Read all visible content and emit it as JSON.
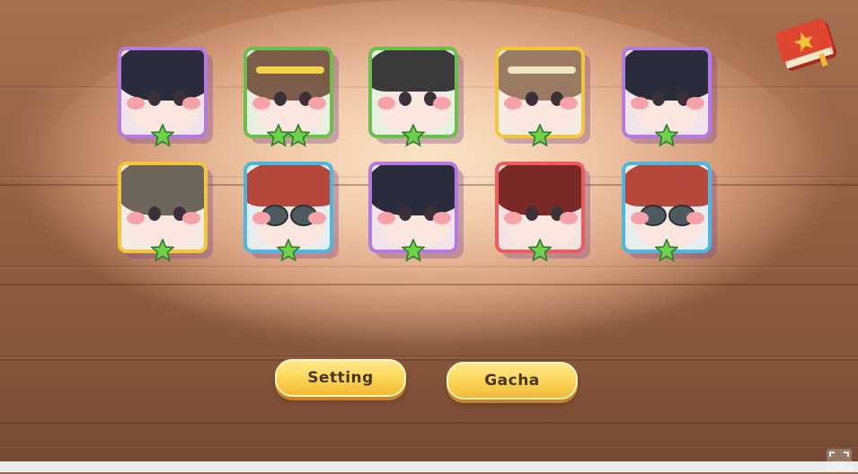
{
  "screen": {
    "buttons": [
      {
        "id": "setting",
        "label": "Setting"
      },
      {
        "id": "gacha",
        "label": "Gacha"
      }
    ]
  },
  "roster": {
    "characters": [
      {
        "slot": 1,
        "hair": "black",
        "frame_color": "#b57ae0",
        "stars": 1
      },
      {
        "slot": 2,
        "hair": "brown",
        "frame_color": "#6cc04a",
        "stars": 2
      },
      {
        "slot": 3,
        "hair": "black-cap",
        "frame_color": "#6cc04a",
        "stars": 1
      },
      {
        "slot": 4,
        "hair": "light-brown-headband",
        "frame_color": "#f3c53a",
        "stars": 1
      },
      {
        "slot": 5,
        "hair": "black",
        "frame_color": "#b57ae0",
        "stars": 1
      },
      {
        "slot": 6,
        "hair": "grey-brown",
        "frame_color": "#f3c53a",
        "stars": 1
      },
      {
        "slot": 7,
        "hair": "red-cap-sunglasses",
        "frame_color": "#4fb6e0",
        "stars": 1
      },
      {
        "slot": 8,
        "hair": "black",
        "frame_color": "#b57ae0",
        "stars": 1
      },
      {
        "slot": 9,
        "hair": "dark-red",
        "frame_color": "#ef5a5a",
        "stars": 1
      },
      {
        "slot": 10,
        "hair": "red-cap-sunglasses",
        "frame_color": "#4fb6e0",
        "stars": 1
      }
    ]
  },
  "icons": {
    "book": "red-book-icon",
    "expand": "expand-icon",
    "star": "green-star-icon"
  },
  "colors": {
    "button_fill": "#fbd455",
    "button_text": "#4a3520",
    "star_green": "#6fd14b",
    "book_red": "#e0452f"
  }
}
